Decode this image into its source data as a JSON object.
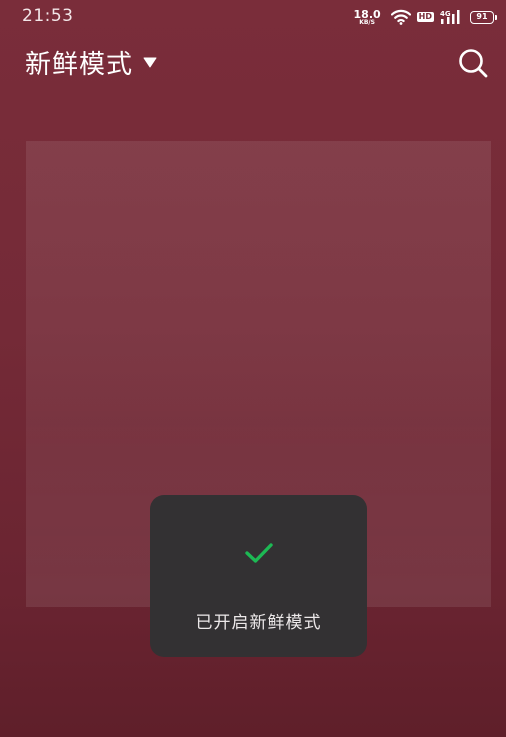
{
  "status_bar": {
    "time": "21:53",
    "net_speed_value": "18.0",
    "net_speed_unit": "KB/S",
    "hd_label": "HD",
    "network_type": "4G",
    "battery_level": "91",
    "icons": [
      "wifi-icon",
      "hd-icon",
      "signal-4g-icon",
      "battery-icon"
    ]
  },
  "header": {
    "title": "新鲜模式",
    "dropdown_icon": "triangle-down-icon",
    "search_icon": "search-icon"
  },
  "toast": {
    "icon": "checkmark-icon",
    "message": "已开启新鲜模式",
    "icon_color": "#1db954"
  },
  "colors": {
    "background": "#7a2d3a",
    "toast_background": "#333133"
  }
}
